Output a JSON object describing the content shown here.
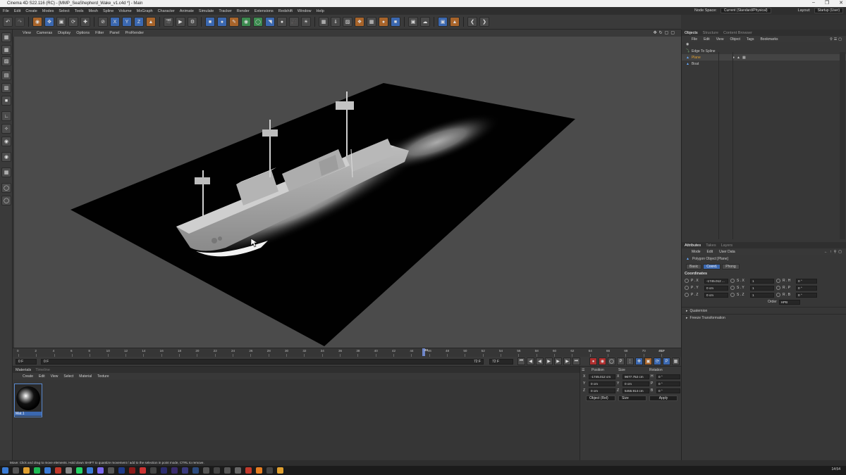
{
  "window": {
    "title": "Cinema 4D S22.116 (RC) - [MMP_SeaShepherd_Wake_v1.c4d *] - Main"
  },
  "menubar": {
    "items": [
      "File",
      "Edit",
      "Create",
      "Modes",
      "Select",
      "Tools",
      "Mesh",
      "Spline",
      "Volume",
      "MoGraph",
      "Character",
      "Animate",
      "Simulate",
      "Tracker",
      "Render",
      "Extensions",
      "Redshift",
      "Window",
      "Help"
    ],
    "node_space_label": "Node Space:",
    "node_space_value": "Current (Standard/Physical)",
    "layout_label": "Layout:",
    "layout_value": "Startup (User)"
  },
  "toolbar": {
    "axis_x": "X",
    "axis_y": "Y",
    "axis_z": "Z"
  },
  "viewport_menu": [
    "View",
    "Cameras",
    "Display",
    "Options",
    "Filter",
    "Panel",
    "ProRender"
  ],
  "timeline": {
    "ticks": [
      "0",
      "2",
      "4",
      "6",
      "8",
      "10",
      "12",
      "14",
      "16",
      "18",
      "20",
      "22",
      "24",
      "26",
      "28",
      "30",
      "32",
      "34",
      "36",
      "38",
      "40",
      "42",
      "44",
      "46",
      "48",
      "50",
      "52",
      "54",
      "56",
      "58",
      "60",
      "62",
      "64",
      "66",
      "68",
      "70",
      "72"
    ],
    "current_frame_label": "46",
    "end_readout": "46 F"
  },
  "playbar": {
    "start_field": "0 F",
    "min_field": "0 F",
    "max_field": "72 F",
    "end_field": "72 F"
  },
  "materials": {
    "tabs": [
      "Materials",
      "Timeline"
    ],
    "menu": [
      "Create",
      "Edit",
      "View",
      "Select",
      "Material",
      "Texture"
    ],
    "items": [
      {
        "name": "Mat.1"
      }
    ]
  },
  "coordinates": {
    "headers": [
      "Position",
      "Size",
      "Rotation"
    ],
    "rows": [
      {
        "axis": "X",
        "pos": "-1745.012 cm",
        "size_axis": "X",
        "size": "9677.752 cm",
        "rot_axis": "H",
        "rot": "0 °"
      },
      {
        "axis": "Y",
        "pos": "0 cm",
        "size_axis": "Y",
        "size": "0 cm",
        "rot_axis": "P",
        "rot": "0 °"
      },
      {
        "axis": "Z",
        "pos": "0 cm",
        "size_axis": "Z",
        "size": "5455.914 cm",
        "rot_axis": "B",
        "rot": "0 °"
      }
    ],
    "mode_dropdown": "Object (Rel)",
    "size_dropdown": "Size",
    "apply_label": "Apply"
  },
  "objects_panel": {
    "tabs": [
      "Objects",
      "Structure",
      "Content Browser"
    ],
    "menu": [
      "File",
      "Edit",
      "View",
      "Object",
      "Tags",
      "Bookmarks"
    ],
    "items": [
      {
        "name": "Edge To Spline",
        "color": "#c8c8c8"
      },
      {
        "name": "Plane",
        "color": "#e0a030"
      },
      {
        "name": "Boat",
        "color": "#c8c8c8"
      }
    ]
  },
  "attributes_panel": {
    "tabs": [
      "Attributes",
      "Takes",
      "Layers"
    ],
    "menu": [
      "Mode",
      "Edit",
      "User Data"
    ],
    "object_label": "Polygon Object [Plane]",
    "subtabs": [
      "Basic",
      "Coord.",
      "Phong"
    ],
    "active_subtab": "Coord.",
    "section_title": "Coordinates",
    "rows": [
      {
        "p_label": "P . X",
        "p_val": "-1745.012 ...",
        "s_label": "S . X",
        "s_val": "1",
        "r_label": "R . H",
        "r_val": "0 °"
      },
      {
        "p_label": "P . Y",
        "p_val": "0 cm",
        "s_label": "S . Y",
        "s_val": "1",
        "r_label": "R . P",
        "r_val": "0 °"
      },
      {
        "p_label": "P . Z",
        "p_val": "0 cm",
        "s_label": "S . Z",
        "s_val": "1",
        "r_label": "R . B",
        "r_val": "0 °"
      }
    ],
    "order_label": "Order",
    "order_value": "HPB",
    "collapsibles": [
      "Quaternion",
      "Freeze Transformation"
    ]
  },
  "statusbar": {
    "text": "Move: Click and drag to move elements. Hold down SHIFT to quantize movement / add to the selection in point mode, CTRL to remove."
  },
  "taskbar": {
    "time": "14:54"
  }
}
